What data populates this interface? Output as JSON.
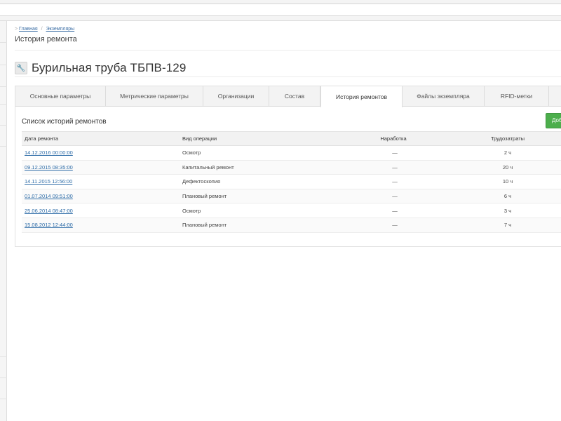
{
  "breadcrumb": {
    "items": [
      "Главная",
      "Экземпляры"
    ]
  },
  "page": {
    "title": "История ремонта"
  },
  "item": {
    "title": "Бурильная труба ТБПВ-129"
  },
  "tabs": [
    {
      "label": "Основные параметры",
      "active": false
    },
    {
      "label": "Метрические параметры",
      "active": false
    },
    {
      "label": "Организации",
      "active": false
    },
    {
      "label": "Состав",
      "active": false
    },
    {
      "label": "История ремонтов",
      "active": true
    },
    {
      "label": "Файлы экземпляра",
      "active": false
    },
    {
      "label": "RFID-метки",
      "active": false
    }
  ],
  "repair_list": {
    "title": "Список историй ремонтов",
    "add_button_label": "Доб",
    "columns": [
      "Дата ремонта",
      "Вид операции",
      "Наработка",
      "Трудозатраты"
    ],
    "rows": [
      {
        "date": "14.12.2016 00:00:00",
        "operation": "Осмотр",
        "hours": "—",
        "labor": "2 ч"
      },
      {
        "date": "09.12.2015 08:35:00",
        "operation": "Капитальный ремонт",
        "hours": "—",
        "labor": "20 ч"
      },
      {
        "date": "14.11.2015 12:56:00",
        "operation": "Дефектоскопия",
        "hours": "—",
        "labor": "10 ч"
      },
      {
        "date": "01.07.2014 09:51:00",
        "operation": "Плановый ремонт",
        "hours": "—",
        "labor": "6 ч"
      },
      {
        "date": "25.06.2014 08:47:00",
        "operation": "Осмотр",
        "hours": "—",
        "labor": "3 ч"
      },
      {
        "date": "15.08.2012 12:44:00",
        "operation": "Плановый ремонт",
        "hours": "—",
        "labor": "7 ч"
      }
    ]
  },
  "colors": {
    "accent_green": "#4cae4c",
    "link_blue": "#2f6da8"
  }
}
